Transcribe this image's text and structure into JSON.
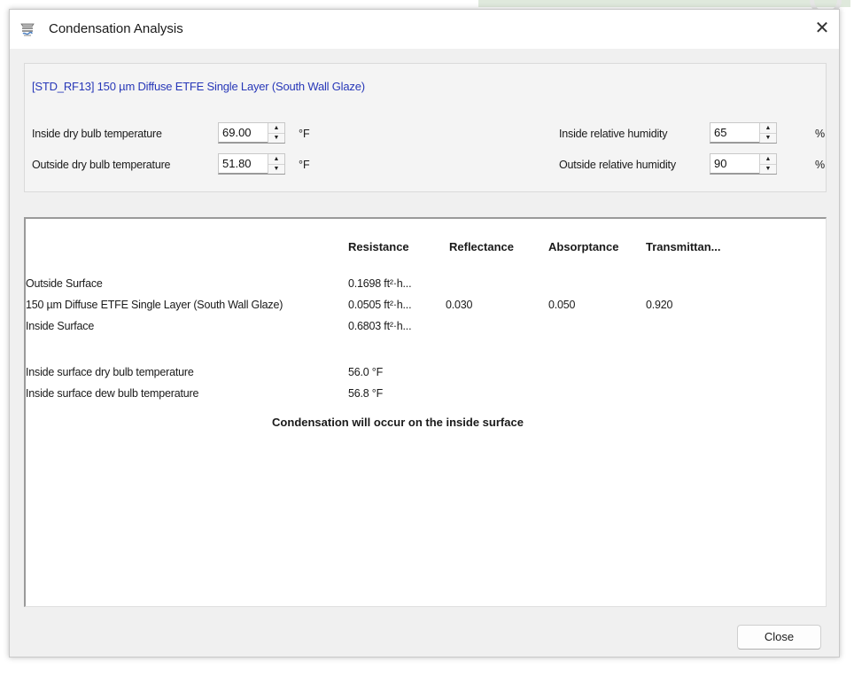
{
  "window": {
    "title": "Condensation Analysis",
    "icon": "radiator-icon",
    "close_glyph": "✕"
  },
  "params": {
    "material_title": "[STD_RF13] 150 µm Diffuse ETFE Single Layer (South Wall Glaze)",
    "inside_dry_bulb": {
      "label": "Inside dry bulb temperature",
      "value": "69.00",
      "unit": "°F"
    },
    "outside_dry_bulb": {
      "label": "Outside dry bulb temperature",
      "value": "51.80",
      "unit": "°F"
    },
    "inside_rh": {
      "label": "Inside relative humidity",
      "value": "65",
      "unit": "%"
    },
    "outside_rh": {
      "label": "Outside relative humidity",
      "value": "90",
      "unit": "%"
    }
  },
  "table": {
    "headers": [
      "Resistance",
      "Reflectance",
      "Absorptance",
      "Transmittan..."
    ],
    "rows": [
      {
        "name": "Outside Surface",
        "resistance": "0.1698 ft²·h...",
        "reflectance": "",
        "absorptance": "",
        "transmittance": ""
      },
      {
        "name": "150 µm Diffuse ETFE Single Layer (South Wall Glaze)",
        "resistance": "0.0505 ft²·h...",
        "reflectance": "0.030",
        "absorptance": "0.050",
        "transmittance": "0.920"
      },
      {
        "name": "Inside Surface",
        "resistance": "0.6803 ft²·h...",
        "reflectance": "",
        "absorptance": "",
        "transmittance": ""
      }
    ],
    "surface_temps": [
      {
        "label": "Inside surface dry bulb temperature",
        "value": "56.0 °F"
      },
      {
        "label": "Inside surface dew bulb temperature",
        "value": "56.8 °F"
      }
    ],
    "message": "Condensation will occur on the inside surface"
  },
  "footer": {
    "close_label": "Close"
  },
  "colors": {
    "material_title": "#2838b8",
    "window_bg": "#f0f0f0"
  }
}
